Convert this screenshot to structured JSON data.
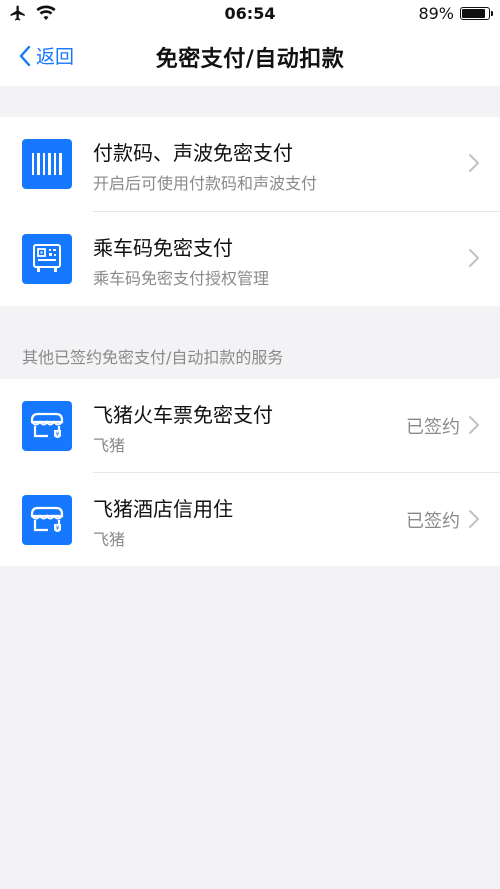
{
  "status_bar": {
    "time": "06:54",
    "battery": "89%",
    "battery_level": 0.89
  },
  "nav": {
    "back_label": "返回",
    "title": "免密支付/自动扣款"
  },
  "main_items": [
    {
      "title": "付款码、声波免密支付",
      "subtitle": "开启后可使用付款码和声波支付",
      "icon": "barcode-icon"
    },
    {
      "title": "乘车码免密支付",
      "subtitle": "乘车码免密支付授权管理",
      "icon": "bus-qr-icon"
    }
  ],
  "other_section": {
    "header": "其他已签约免密支付/自动扣款的服务",
    "items": [
      {
        "title": "飞猪火车票免密支付",
        "subtitle": "飞猪",
        "status": "已签约",
        "icon": "fliggy-store-icon"
      },
      {
        "title": "飞猪酒店信用住",
        "subtitle": "飞猪",
        "status": "已签约",
        "icon": "fliggy-store-icon"
      }
    ]
  },
  "colors": {
    "accent": "#1677ff",
    "background": "#f3f3f5",
    "secondary_text": "#8a8a8a"
  }
}
